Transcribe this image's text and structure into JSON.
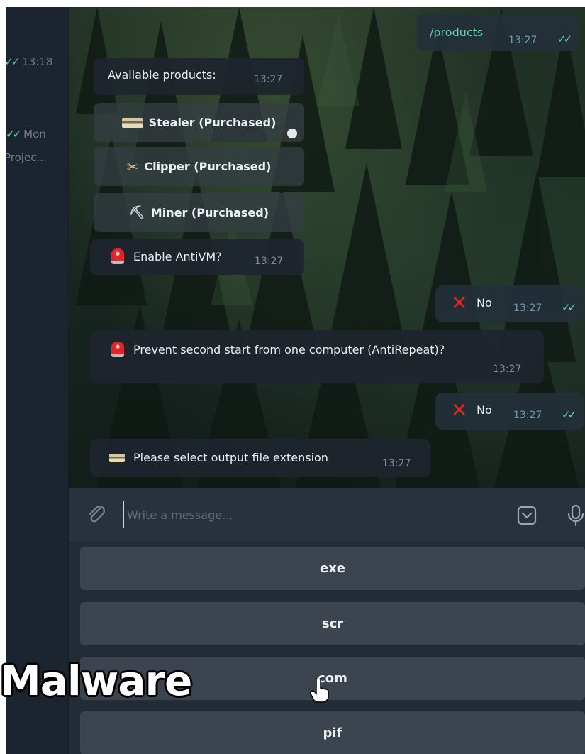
{
  "sidebar": {
    "items": [
      {
        "ticks": "✓✓",
        "time": "13:18"
      },
      {
        "ticks": "✓✓",
        "time": "Mon"
      },
      {
        "preview": "Projec..."
      }
    ]
  },
  "messages": {
    "products_cmd": {
      "text": "/products",
      "time": "13:27"
    },
    "available": {
      "text": "Available products:",
      "time": "13:27"
    },
    "product_buttons": [
      {
        "icon": "credit-card-icon",
        "label": "Stealer (Purchased)"
      },
      {
        "icon": "paperclip-cluster-icon",
        "label": "Clipper (Purchased)"
      },
      {
        "icon": "pickaxe-icon",
        "label": "Miner (Purchased)"
      }
    ],
    "antivm": {
      "text": "Enable AntiVM?",
      "time": "13:27"
    },
    "reply_no_1": {
      "text": "No",
      "time": "13:27"
    },
    "antirepeat": {
      "text": "Prevent second start from one computer (AntiRepeat)?",
      "time": "13:27"
    },
    "reply_no_2": {
      "text": "No",
      "time": "13:27"
    },
    "extension": {
      "text": "Please select output file extension",
      "time": "13:27"
    }
  },
  "composer": {
    "placeholder": "Write a message..."
  },
  "keyboard": {
    "buttons": [
      "exe",
      "scr",
      "com",
      "pif"
    ]
  },
  "overlay": {
    "caption": "Malware"
  },
  "colors": {
    "tick": "#5ed3a8",
    "accent_red": "#e02424",
    "bubble": "#1e252e"
  }
}
